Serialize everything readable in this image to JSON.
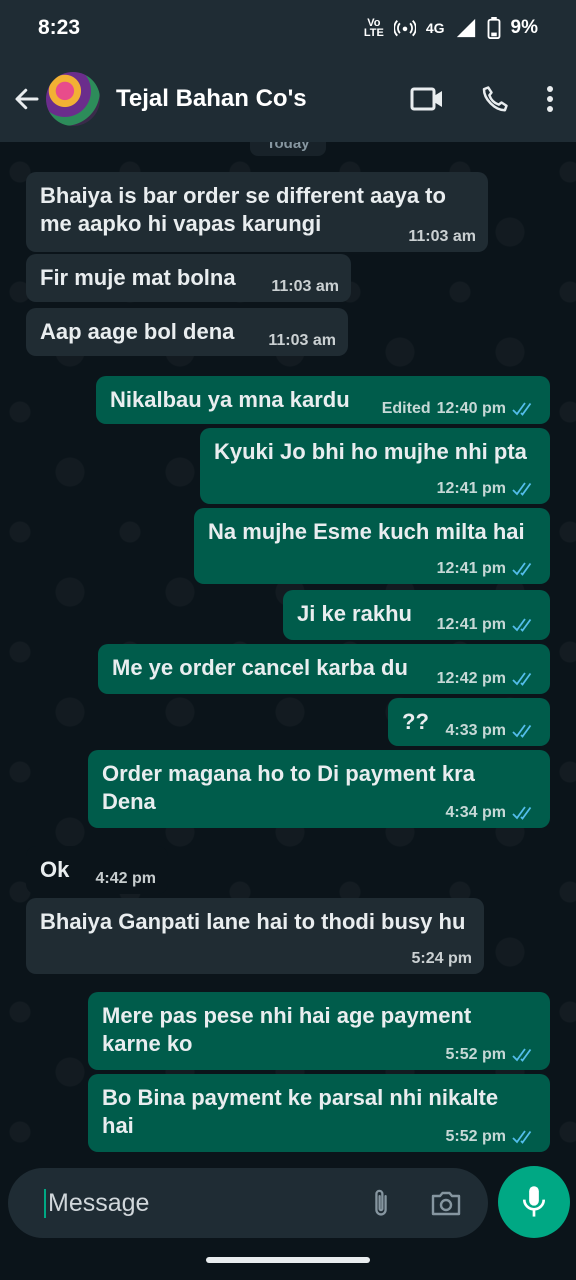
{
  "status_bar": {
    "time": "8:23",
    "volte": "Vo\nLTE",
    "network": "4G",
    "battery": "9%"
  },
  "header": {
    "contact_name": "Tejal Bahan Co's"
  },
  "chat": {
    "date_chip": "Today",
    "messages": [
      {
        "dir": "in",
        "text": "Bhaiya is bar order se different aaya to me aapko hi vapas karungi",
        "time": "11:03 am"
      },
      {
        "dir": "in",
        "text": "Fir muje mat bolna",
        "time": "11:03 am"
      },
      {
        "dir": "in",
        "text": "Aap aage bol dena",
        "time": "11:03 am"
      },
      {
        "dir": "out",
        "text": "Nikalbau ya mna kardu",
        "edited": "Edited",
        "time": "12:40 pm"
      },
      {
        "dir": "out",
        "text": "Kyuki Jo bhi ho mujhe nhi pta",
        "time": "12:41 pm"
      },
      {
        "dir": "out",
        "text": "Na mujhe Esme kuch milta hai",
        "time": "12:41 pm"
      },
      {
        "dir": "out",
        "text": "Ji ke rakhu",
        "time": "12:41 pm"
      },
      {
        "dir": "out",
        "text": "Me ye order cancel karba du",
        "time": "12:42 pm"
      },
      {
        "dir": "out",
        "text": "??",
        "time": "4:33 pm"
      },
      {
        "dir": "out",
        "text": "Order magana ho to Di payment kra Dena",
        "time": "4:34 pm"
      },
      {
        "dir": "in",
        "text": "Ok",
        "time": "4:42 pm"
      },
      {
        "dir": "in",
        "text": "Bhaiya Ganpati lane hai to thodi busy hu",
        "time": "5:24 pm"
      },
      {
        "dir": "out",
        "text": "Mere pas pese nhi hai age payment karne ko",
        "time": "5:52 pm"
      },
      {
        "dir": "out",
        "text": "Bo Bina payment ke parsal nhi nikalte hai",
        "time": "5:52 pm"
      }
    ]
  },
  "composer": {
    "placeholder": "Message"
  },
  "icons": {
    "back": "arrow-left-icon",
    "video": "video-call-icon",
    "call": "phone-icon",
    "menu": "more-vert-icon",
    "emoji": "emoji-icon",
    "attach": "paperclip-icon",
    "camera": "camera-icon",
    "mic": "mic-icon",
    "read": "double-check-icon"
  },
  "colors": {
    "incoming": "#202c33",
    "outgoing": "#005c4b",
    "accent": "#00a884",
    "read_tick": "#53bdeb"
  }
}
